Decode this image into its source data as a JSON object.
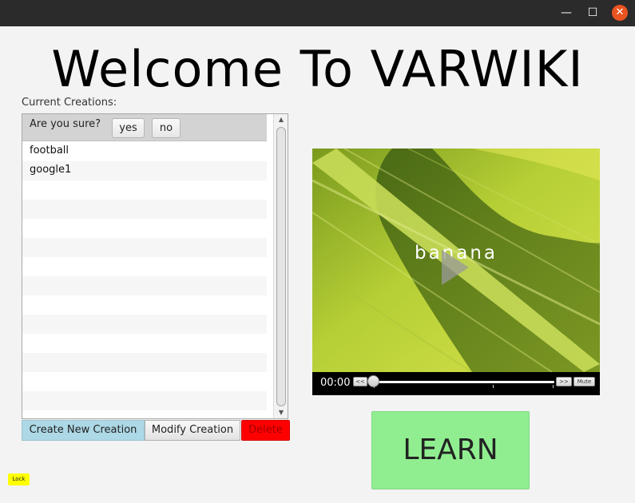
{
  "window": {
    "minimize_glyph": "—",
    "maximize_glyph": "☐",
    "close_glyph": "✕"
  },
  "title": "Welcome To VARWIKI",
  "creations": {
    "label": "Current Creations:",
    "confirm": {
      "question": "Are you sure?",
      "yes_label": "yes",
      "no_label": "no"
    },
    "items": [
      "football",
      "google1",
      "",
      "",
      "",
      "",
      "",
      "",
      "",
      "",
      "",
      "",
      "",
      "",
      ""
    ]
  },
  "actions": {
    "create_label": "Create New Creation",
    "modify_label": "Modify Creation",
    "delete_label": "Delete"
  },
  "video": {
    "caption": "banana",
    "time": "00:00",
    "progress": 0.0,
    "rewind_label": "<<",
    "forward_label": ">>",
    "mute_label": "Mute"
  },
  "learn_label": "LEARN",
  "lock_label": "Lock",
  "colors": {
    "create": "#add8e6",
    "delete": "#ff0000",
    "learn": "#90ee90",
    "lock": "#ffff00"
  }
}
